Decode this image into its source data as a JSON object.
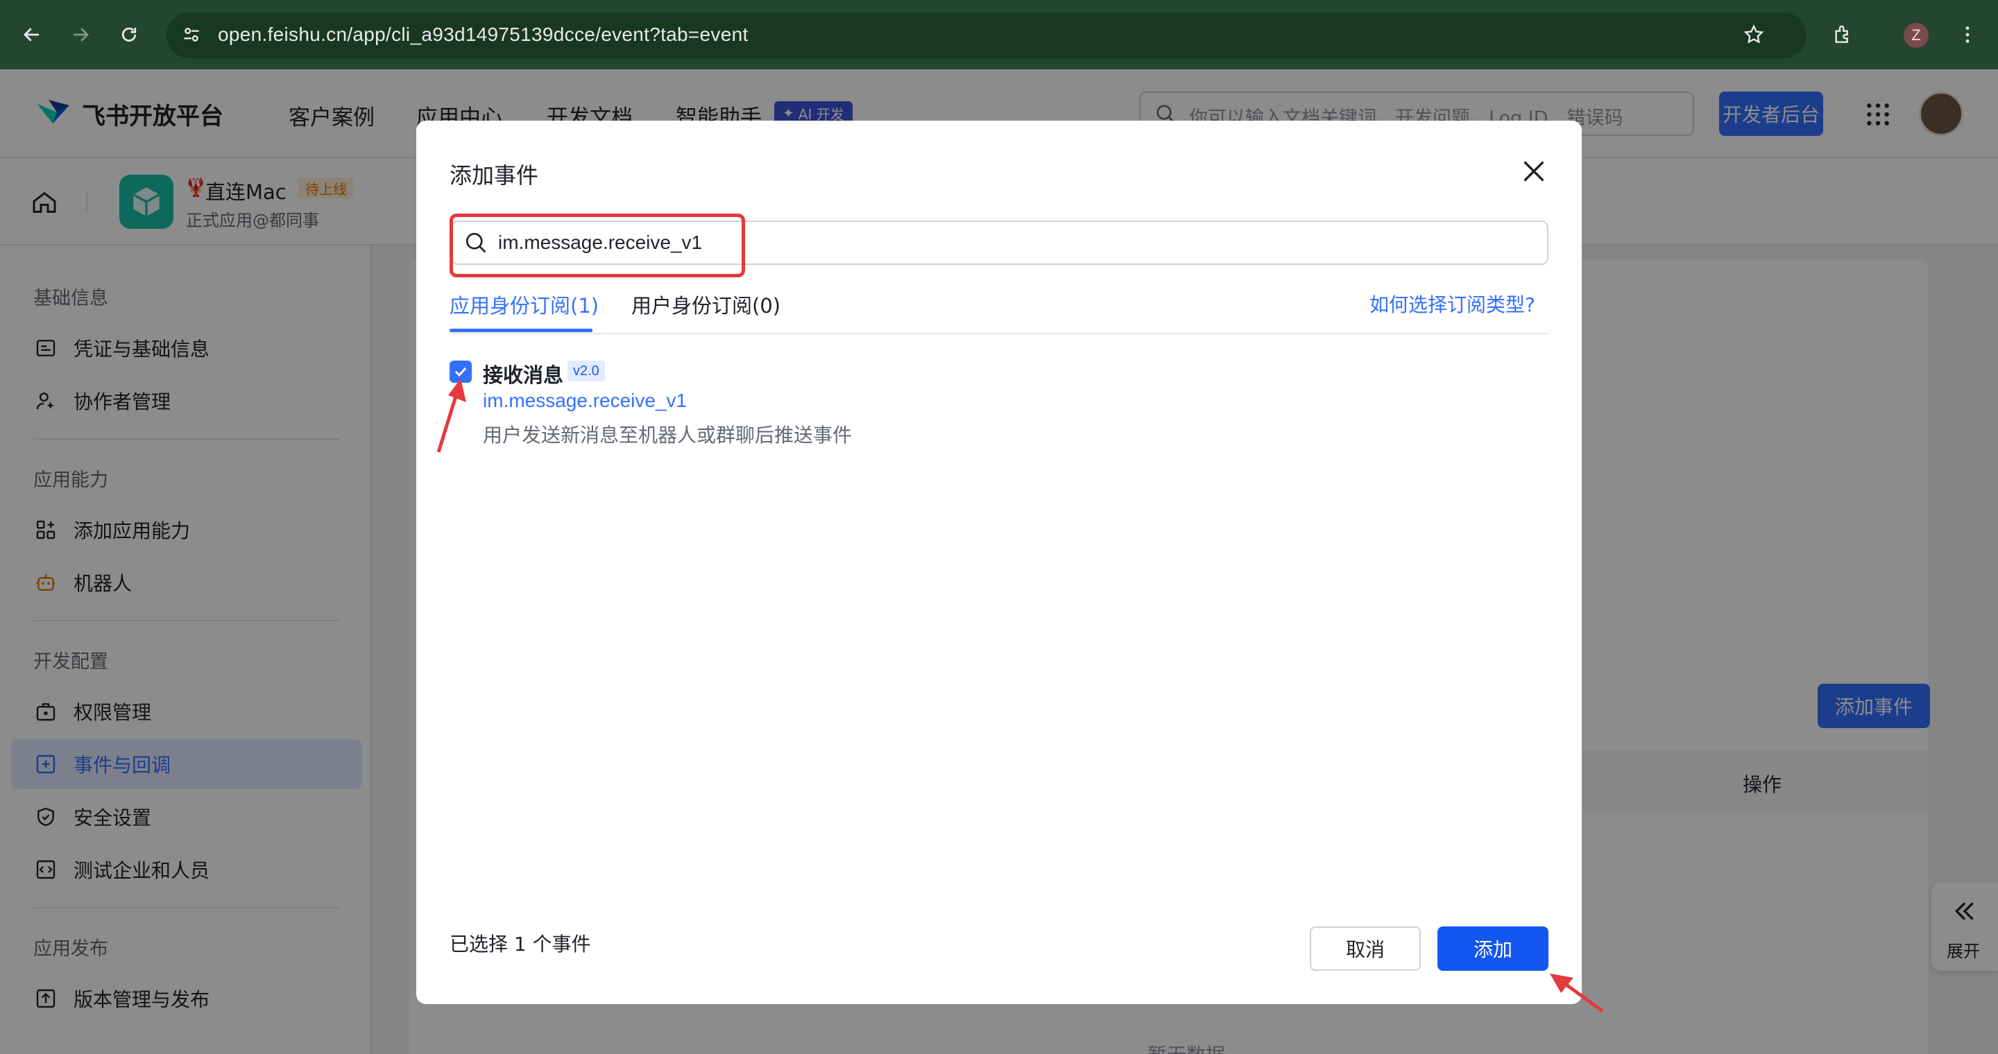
{
  "browser": {
    "url": "open.feishu.cn/app/cli_a93d14975139dcce/event?tab=event",
    "profile_initial": "Z"
  },
  "site": {
    "brand": "飞书开放平台",
    "nav": [
      "客户案例",
      "应用中心",
      "开发文档",
      "智能助手"
    ],
    "ai_badge": "AI 开发",
    "search_placeholder": "你可以输入文档关键词、开发问题、Log ID、错误码",
    "dev_console": "开发者后台"
  },
  "app": {
    "name": "直连Mac",
    "status": "待上线",
    "type": "正式应用@都同事"
  },
  "sidebar": {
    "groups": [
      {
        "title": "基础信息",
        "items": [
          "凭证与基础信息",
          "协作者管理"
        ]
      },
      {
        "title": "应用能力",
        "items": [
          "添加应用能力",
          "机器人"
        ]
      },
      {
        "title": "开发配置",
        "items": [
          "权限管理",
          "事件与回调",
          "安全设置",
          "测试企业和人员"
        ]
      },
      {
        "title": "应用发布",
        "items": [
          "版本管理与发布"
        ]
      }
    ],
    "active": "事件与回调"
  },
  "background": {
    "add_event": "添加事件",
    "ops_column": "操作",
    "no_data": "暂无数据",
    "expand": "展开"
  },
  "modal": {
    "title": "添加事件",
    "search_value": "im.message.receive_v1",
    "tabs": [
      {
        "label": "应用身份订阅(1)",
        "active": true
      },
      {
        "label": "用户身份订阅(0)",
        "active": false
      }
    ],
    "help_link": "如何选择订阅类型?",
    "events": [
      {
        "name": "接收消息",
        "version": "v2.0",
        "key": "im.message.receive_v1",
        "description": "用户发送新消息至机器人或群聊后推送事件",
        "checked": true
      }
    ],
    "selected_count": "已选择 1 个事件",
    "cancel": "取消",
    "add": "添加"
  },
  "colors": {
    "primary": "#3370ff",
    "annotation_red": "#e5393c",
    "chrome_green": "#24452f"
  }
}
